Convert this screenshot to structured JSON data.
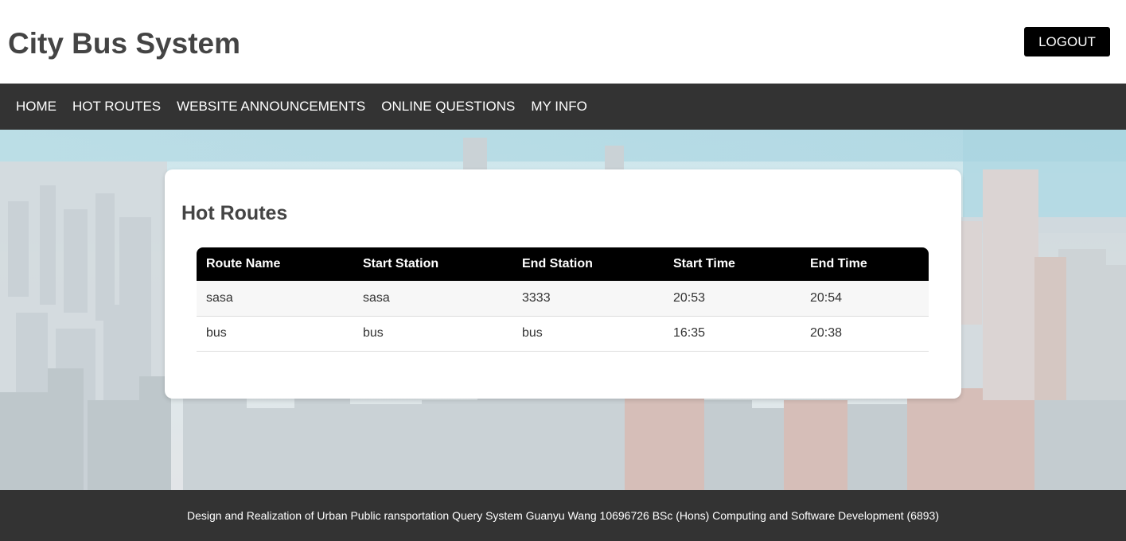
{
  "header": {
    "title": "City Bus System",
    "logout_label": "LOGOUT"
  },
  "nav": {
    "items": [
      {
        "label": "HOME"
      },
      {
        "label": "HOT ROUTES"
      },
      {
        "label": "WEBSITE ANNOUNCEMENTS"
      },
      {
        "label": "ONLINE QUESTIONS"
      },
      {
        "label": "MY INFO"
      }
    ]
  },
  "main": {
    "section_title": "Hot Routes",
    "table": {
      "columns": [
        "Route Name",
        "Start Station",
        "End Station",
        "Start Time",
        "End Time"
      ],
      "rows": [
        [
          "sasa",
          "sasa",
          "3333",
          "20:53",
          "20:54"
        ],
        [
          "bus",
          "bus",
          "bus",
          "16:35",
          "20:38"
        ]
      ]
    }
  },
  "footer": {
    "text": "Design and Realization of Urban Public ransportation Query System Guanyu Wang 10696726 BSc (Hons) Computing and Software Development (6893)"
  },
  "colors": {
    "nav_bg": "#333333",
    "footer_bg": "#333333",
    "button_bg": "#000000",
    "table_header_bg": "#000000"
  }
}
